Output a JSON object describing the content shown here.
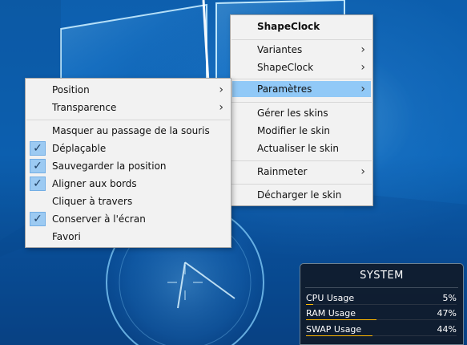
{
  "left_menu": {
    "items": [
      {
        "label": "Position",
        "submenu": true
      },
      {
        "label": "Transparence",
        "submenu": true
      },
      {
        "label": "Masquer au passage de la souris",
        "checked": false
      },
      {
        "label": "Déplaçable",
        "checked": true
      },
      {
        "label": "Sauvegarder la position",
        "checked": true
      },
      {
        "label": "Aligner aux bords",
        "checked": true
      },
      {
        "label": "Cliquer à travers",
        "checked": false
      },
      {
        "label": "Conserver à l'écran",
        "checked": true
      },
      {
        "label": "Favori",
        "checked": false
      }
    ]
  },
  "right_menu": {
    "title": "ShapeClock",
    "items": [
      {
        "label": "Variantes",
        "submenu": true
      },
      {
        "label": "ShapeClock",
        "submenu": true
      },
      {
        "label": "Paramètres",
        "submenu": true,
        "highlighted": true
      },
      {
        "label": "Gérer les skins"
      },
      {
        "label": "Modifier le skin"
      },
      {
        "label": "Actualiser le skin"
      },
      {
        "label": "Rainmeter",
        "submenu": true
      },
      {
        "label": "Décharger le skin"
      }
    ]
  },
  "system_widget": {
    "title": "SYSTEM",
    "metrics": [
      {
        "label": "CPU Usage",
        "value": "5%",
        "fraction": 0.05
      },
      {
        "label": "RAM Usage",
        "value": "47%",
        "fraction": 0.47
      },
      {
        "label": "SWAP Usage",
        "value": "44%",
        "fraction": 0.44
      }
    ]
  },
  "icons": {
    "submenu_arrow": "chevron-right-icon",
    "checkmark": "check-icon",
    "wallpaper_logo": "windows-logo",
    "clock": "clock-icon"
  },
  "colors": {
    "menu_highlight": "#91c9f7",
    "metric_bar": "#ffb700",
    "desktop_blue": "#0d67bb"
  }
}
